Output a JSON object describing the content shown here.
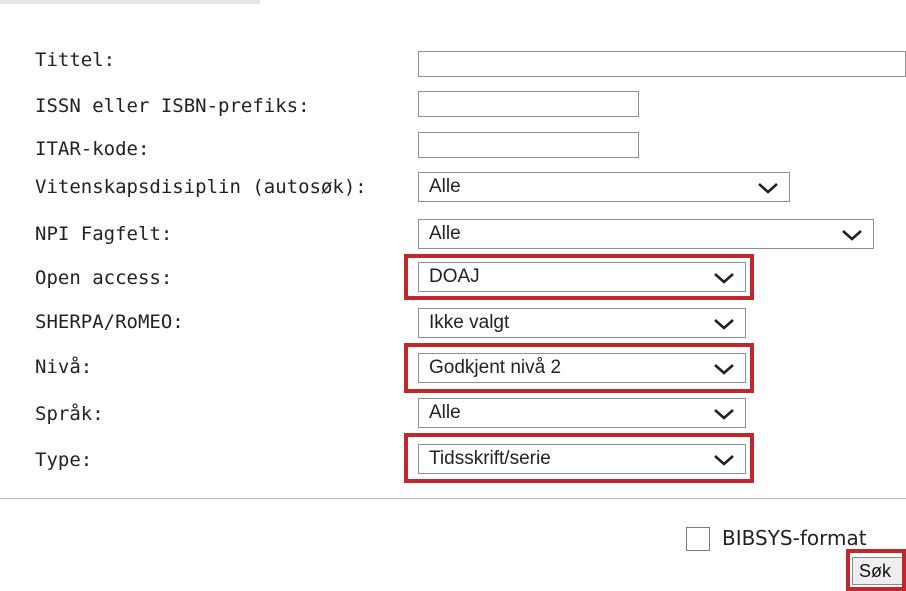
{
  "form": {
    "fields": [
      {
        "label": "Tittel:",
        "value": ""
      },
      {
        "label": "ISSN eller ISBN-prefiks:",
        "value": ""
      },
      {
        "label": "ITAR-kode:",
        "value": ""
      },
      {
        "label": "Vitenskapsdisiplin (autosøk):",
        "value": "Alle"
      },
      {
        "label": "NPI Fagfelt:",
        "value": "Alle"
      },
      {
        "label": "Open access:",
        "value": "DOAJ"
      },
      {
        "label": "SHERPA/RoMEO:",
        "value": "Ikke valgt"
      },
      {
        "label": "Nivå:",
        "value": "Godkjent nivå 2"
      },
      {
        "label": "Språk:",
        "value": "Alle"
      },
      {
        "label": "Type:",
        "value": "Tidsskrift/serie"
      }
    ],
    "bibsys_label": "BIBSYS-format",
    "bibsys_checked": false,
    "search_button": "Søk"
  },
  "colors": {
    "highlight": "#c0282d",
    "border": "#8f8f8f"
  },
  "icons": [
    "chevron-down-icon"
  ]
}
